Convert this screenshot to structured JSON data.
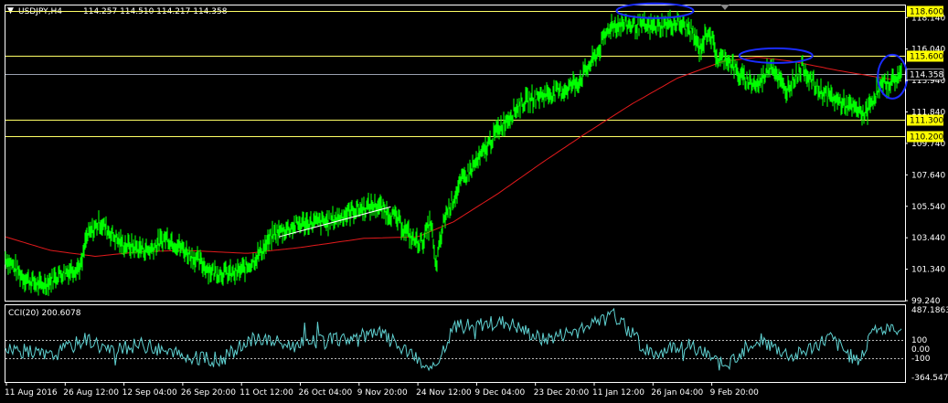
{
  "header": {
    "symbol_timeframe": "USDJPY,H4",
    "quote": "114.257 114.510 114.217 114.358"
  },
  "colors": {
    "background": "#000000",
    "price_series": "#00ff00",
    "moving_average": "#e31a1c",
    "horizontal_lines": "#ffff66",
    "price_line": "#9aa0b0",
    "cci": "#5fd0d0",
    "annotation": "#1a2cff",
    "axes": "#ffffff"
  },
  "chart_data": [
    {
      "type": "line",
      "name": "main-price-chart",
      "ylim": [
        99.24,
        118.95
      ],
      "y_ticks": [
        "118.140",
        "116.040",
        "113.940",
        "111.840",
        "109.740",
        "107.640",
        "105.540",
        "103.440",
        "101.340",
        "99.240"
      ],
      "x_labels": [
        "11 Aug 2016",
        "26 Aug 12:00",
        "12 Sep 04:00",
        "26 Sep 20:00",
        "11 Oct 12:00",
        "26 Oct 04:00",
        "9 Nov 20:00",
        "24 Nov 12:00",
        "9 Dec 04:00",
        "23 Dec 20:00",
        "11 Jan 12:00",
        "26 Jan 04:00",
        "9 Feb 20:00"
      ],
      "price_keypoints": [
        [
          0,
          102.1
        ],
        [
          0.02,
          100.8
        ],
        [
          0.04,
          100.2
        ],
        [
          0.06,
          101.0
        ],
        [
          0.085,
          101.6
        ],
        [
          0.09,
          103.4
        ],
        [
          0.105,
          104.5
        ],
        [
          0.13,
          103.0
        ],
        [
          0.16,
          102.6
        ],
        [
          0.18,
          103.5
        ],
        [
          0.2,
          102.6
        ],
        [
          0.23,
          101.2
        ],
        [
          0.255,
          101.0
        ],
        [
          0.27,
          101.5
        ],
        [
          0.285,
          102.5
        ],
        [
          0.3,
          103.7
        ],
        [
          0.33,
          104.4
        ],
        [
          0.36,
          104.5
        ],
        [
          0.39,
          105.3
        ],
        [
          0.415,
          105.6
        ],
        [
          0.435,
          104.8
        ],
        [
          0.455,
          103.3
        ],
        [
          0.465,
          103.1
        ],
        [
          0.475,
          104.6
        ],
        [
          0.48,
          101.3
        ],
        [
          0.49,
          104.8
        ],
        [
          0.51,
          107.3
        ],
        [
          0.53,
          108.8
        ],
        [
          0.55,
          110.7
        ],
        [
          0.575,
          112.4
        ],
        [
          0.6,
          113.0
        ],
        [
          0.62,
          113.2
        ],
        [
          0.64,
          113.9
        ],
        [
          0.66,
          115.7
        ],
        [
          0.675,
          117.6
        ],
        [
          0.69,
          117.7
        ],
        [
          0.72,
          117.5
        ],
        [
          0.75,
          117.8
        ],
        [
          0.765,
          117.3
        ],
        [
          0.775,
          116.0
        ],
        [
          0.785,
          117.4
        ],
        [
          0.795,
          115.3
        ],
        [
          0.805,
          115.5
        ],
        [
          0.82,
          114.2
        ],
        [
          0.84,
          113.6
        ],
        [
          0.855,
          115.1
        ],
        [
          0.87,
          113.2
        ],
        [
          0.89,
          114.9
        ],
        [
          0.905,
          113.4
        ],
        [
          0.925,
          112.7
        ],
        [
          0.945,
          112.1
        ],
        [
          0.96,
          111.7
        ],
        [
          0.975,
          113.5
        ],
        [
          0.99,
          113.9
        ],
        [
          1.0,
          114.4
        ]
      ],
      "ma_keypoints": [
        [
          0,
          103.5
        ],
        [
          0.05,
          102.6
        ],
        [
          0.1,
          102.2
        ],
        [
          0.15,
          102.5
        ],
        [
          0.2,
          102.6
        ],
        [
          0.27,
          102.4
        ],
        [
          0.33,
          102.8
        ],
        [
          0.4,
          103.4
        ],
        [
          0.46,
          103.5
        ],
        [
          0.5,
          104.5
        ],
        [
          0.55,
          106.4
        ],
        [
          0.6,
          108.5
        ],
        [
          0.65,
          110.5
        ],
        [
          0.7,
          112.4
        ],
        [
          0.75,
          114.1
        ],
        [
          0.8,
          115.2
        ],
        [
          0.84,
          115.5
        ],
        [
          0.88,
          115.2
        ],
        [
          0.93,
          114.6
        ],
        [
          1.0,
          113.9
        ]
      ],
      "levels": [
        {
          "label": "118.600",
          "value": 118.6
        },
        {
          "label": "115.600",
          "value": 115.6
        },
        {
          "label": "111.300",
          "value": 111.3
        },
        {
          "label": "110.200",
          "value": 110.2
        }
      ],
      "current_price": {
        "label": "114.358",
        "value": 114.358
      },
      "trendline": {
        "from": [
          0.305,
          103.5
        ],
        "to": [
          0.43,
          105.5
        ]
      },
      "annotations": [
        {
          "shape": "ellipse",
          "center": [
            0.725,
            118.6
          ]
        },
        {
          "shape": "ellipse",
          "center": [
            0.86,
            115.6
          ]
        },
        {
          "shape": "ellipse",
          "center": [
            0.99,
            114.2
          ]
        }
      ]
    },
    {
      "type": "line",
      "name": "cci-indicator",
      "title": "CCI(20) 200.6078",
      "ylim": [
        -364.5479,
        487.1863
      ],
      "y_ticks": [
        "487.1863",
        "100",
        "0.00",
        "-100",
        "-364.5479"
      ],
      "reference_levels": [
        100,
        -100
      ],
      "cci_keypoints": [
        [
          0,
          20
        ],
        [
          0.05,
          -80
        ],
        [
          0.09,
          120
        ],
        [
          0.12,
          -30
        ],
        [
          0.15,
          60
        ],
        [
          0.2,
          -90
        ],
        [
          0.24,
          -120
        ],
        [
          0.28,
          130
        ],
        [
          0.32,
          40
        ],
        [
          0.36,
          90
        ],
        [
          0.42,
          180
        ],
        [
          0.46,
          -130
        ],
        [
          0.48,
          -250
        ],
        [
          0.5,
          250
        ],
        [
          0.56,
          300
        ],
        [
          0.6,
          100
        ],
        [
          0.64,
          220
        ],
        [
          0.68,
          380
        ],
        [
          0.72,
          -60
        ],
        [
          0.76,
          80
        ],
        [
          0.8,
          -180
        ],
        [
          0.84,
          110
        ],
        [
          0.88,
          -90
        ],
        [
          0.92,
          130
        ],
        [
          0.95,
          -140
        ],
        [
          0.97,
          230
        ],
        [
          1.0,
          200
        ]
      ]
    }
  ]
}
